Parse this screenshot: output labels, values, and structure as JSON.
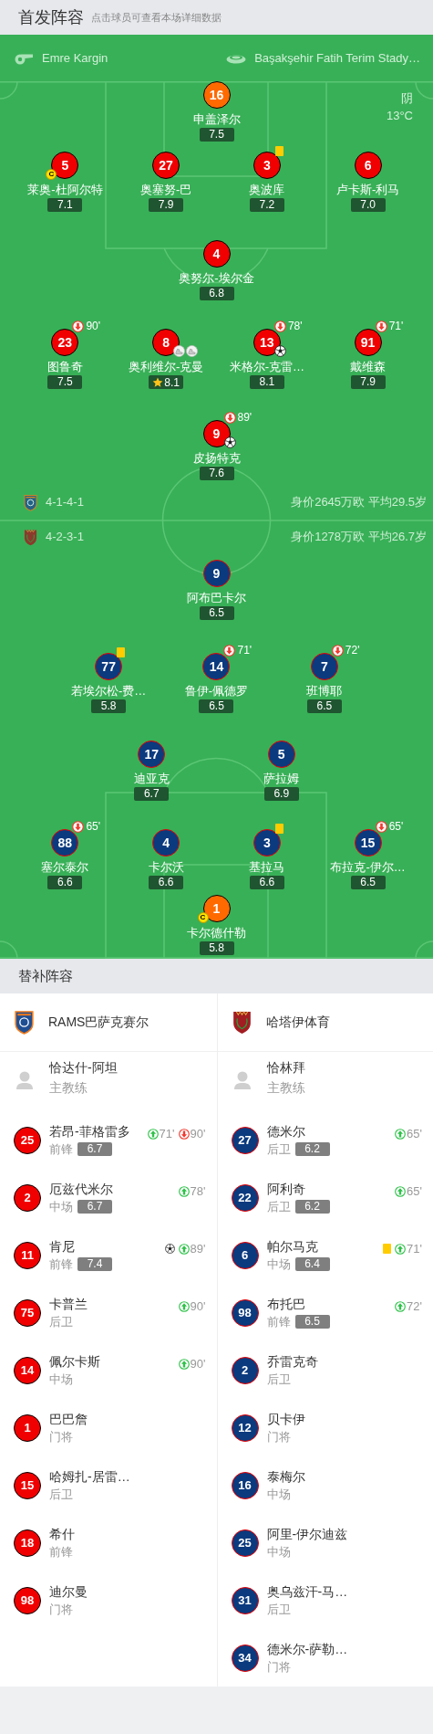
{
  "header": {
    "title": "首发阵容",
    "subtitle": "点击球员可查看本场详细数据"
  },
  "match_info": {
    "referee": "Emre Kargin",
    "stadium": "Başakşehir Fatih Terim Stady…",
    "weather": "阴",
    "temperature": "13°C"
  },
  "home": {
    "kind": "home",
    "formation": "4-1-4-1",
    "summary": "身价2645万欧 平均29.5岁",
    "rows": [
      [
        {
          "number": "16",
          "name": "申盖泽尔",
          "rating": "7.5",
          "kind": "goalkeeper"
        }
      ],
      [
        {
          "number": "5",
          "name": "莱奥-杜阿尔特",
          "rating": "7.1",
          "kind": "outfield",
          "events": [
            {
              "kind": "captain",
              "label": "C"
            }
          ]
        },
        {
          "number": "27",
          "name": "奥塞努-巴",
          "rating": "7.9",
          "kind": "outfield"
        },
        {
          "number": "3",
          "name": "奥波库",
          "rating": "7.2",
          "kind": "outfield",
          "events": [
            {
              "kind": "yellow_card"
            }
          ]
        },
        {
          "number": "6",
          "name": "卢卡斯-利马",
          "rating": "7.0",
          "kind": "outfield"
        }
      ],
      [
        {
          "number": "4",
          "name": "奥努尔-埃尔金",
          "rating": "6.8",
          "kind": "outfield"
        }
      ],
      [
        {
          "number": "23",
          "name": "图鲁奇",
          "rating": "7.5",
          "kind": "outfield",
          "events": [
            {
              "kind": "sub_off",
              "minute": "90'"
            }
          ]
        },
        {
          "number": "8",
          "name": "奥利维尔-克曼",
          "rating": "8.1",
          "kind": "outfield",
          "best": true,
          "events": [
            {
              "kind": "assist"
            },
            {
              "kind": "assist"
            }
          ]
        },
        {
          "number": "13",
          "name": "米格尔-克雷…",
          "rating": "8.1",
          "kind": "outfield",
          "events": [
            {
              "kind": "sub_off",
              "minute": "78'"
            },
            {
              "kind": "goal"
            }
          ]
        },
        {
          "number": "91",
          "name": "戴维森",
          "rating": "7.9",
          "kind": "outfield",
          "events": [
            {
              "kind": "sub_off",
              "minute": "71'"
            }
          ]
        }
      ],
      [
        {
          "number": "9",
          "name": "皮扬特克",
          "rating": "7.6",
          "kind": "outfield",
          "events": [
            {
              "kind": "sub_off",
              "minute": "89'"
            },
            {
              "kind": "goal"
            }
          ]
        }
      ]
    ]
  },
  "away": {
    "kind": "away",
    "formation": "4-2-3-1",
    "summary": "身价1278万欧 平均26.7岁",
    "rows": [
      [
        {
          "number": "9",
          "name": "阿布巴卡尔",
          "rating": "6.5",
          "kind": "outfield"
        }
      ],
      [
        {
          "number": "77",
          "name": "若埃尔松-费…",
          "rating": "5.8",
          "kind": "outfield",
          "events": [
            {
              "kind": "yellow_card"
            }
          ]
        },
        {
          "number": "14",
          "name": "鲁伊-佩德罗",
          "rating": "6.5",
          "kind": "outfield",
          "events": [
            {
              "kind": "sub_off",
              "minute": "71'"
            }
          ]
        },
        {
          "number": "7",
          "name": "班博耶",
          "rating": "6.5",
          "kind": "outfield",
          "events": [
            {
              "kind": "sub_off",
              "minute": "72'"
            }
          ]
        }
      ],
      [
        {
          "number": "17",
          "name": "迪亚克",
          "rating": "6.7",
          "kind": "outfield"
        },
        {
          "number": "5",
          "name": "萨拉姆",
          "rating": "6.9",
          "kind": "outfield"
        }
      ],
      [
        {
          "number": "88",
          "name": "塞尔泰尔",
          "rating": "6.6",
          "kind": "outfield",
          "events": [
            {
              "kind": "sub_off",
              "minute": "65'"
            }
          ]
        },
        {
          "number": "4",
          "name": "卡尔沃",
          "rating": "6.6",
          "kind": "outfield"
        },
        {
          "number": "3",
          "name": "基拉马",
          "rating": "6.6",
          "kind": "outfield",
          "events": [
            {
              "kind": "yellow_card"
            }
          ]
        },
        {
          "number": "15",
          "name": "布拉克-伊尔…",
          "rating": "6.5",
          "kind": "outfield",
          "events": [
            {
              "kind": "sub_off",
              "minute": "65'"
            }
          ]
        }
      ],
      [
        {
          "number": "1",
          "name": "卡尔德什勒",
          "rating": "5.8",
          "kind": "goalkeeper",
          "events": [
            {
              "kind": "captain",
              "label": "C"
            }
          ]
        }
      ]
    ]
  },
  "substitutes": {
    "title": "替补阵容",
    "teams": [
      {
        "kind": "home",
        "name": "RAMS巴萨克赛尔",
        "coach": {
          "name": "恰达什-阿坦",
          "role": "主教练"
        },
        "players": [
          {
            "number": "25",
            "name": "若昂-菲格雷多",
            "position": "前锋",
            "rating": "6.7",
            "events": [
              {
                "kind": "sub_in",
                "minute": "71'"
              },
              {
                "kind": "sub_out",
                "minute": "90'"
              }
            ]
          },
          {
            "number": "2",
            "name": "厄兹代米尔",
            "position": "中场",
            "rating": "6.7",
            "events": [
              {
                "kind": "sub_in",
                "minute": "78'"
              }
            ]
          },
          {
            "number": "11",
            "name": "肯尼",
            "position": "前锋",
            "rating": "7.4",
            "events": [
              {
                "kind": "goal"
              },
              {
                "kind": "sub_in",
                "minute": "89'"
              }
            ]
          },
          {
            "number": "75",
            "name": "卡普兰",
            "position": "后卫",
            "events": [
              {
                "kind": "sub_in",
                "minute": "90'"
              }
            ]
          },
          {
            "number": "14",
            "name": "佩尔卡斯",
            "position": "中场",
            "events": [
              {
                "kind": "sub_in",
                "minute": "90'"
              }
            ]
          },
          {
            "number": "1",
            "name": "巴巴詹",
            "position": "门将"
          },
          {
            "number": "15",
            "name": "哈姆扎-居雷…",
            "position": "后卫"
          },
          {
            "number": "18",
            "name": "希什",
            "position": "前锋"
          },
          {
            "number": "98",
            "name": "迪尔曼",
            "position": "门将"
          }
        ]
      },
      {
        "kind": "away",
        "name": "哈塔伊体育",
        "coach": {
          "name": "恰林拜",
          "role": "主教练"
        },
        "players": [
          {
            "number": "27",
            "name": "德米尔",
            "position": "后卫",
            "rating": "6.2",
            "events": [
              {
                "kind": "sub_in",
                "minute": "65'"
              }
            ]
          },
          {
            "number": "22",
            "name": "阿利奇",
            "position": "后卫",
            "rating": "6.2",
            "events": [
              {
                "kind": "sub_in",
                "minute": "65'"
              }
            ]
          },
          {
            "number": "6",
            "name": "帕尔马克",
            "position": "中场",
            "rating": "6.4",
            "events": [
              {
                "kind": "yellow_card"
              },
              {
                "kind": "sub_in",
                "minute": "71'"
              }
            ]
          },
          {
            "number": "98",
            "name": "布托巴",
            "position": "前锋",
            "rating": "6.5",
            "events": [
              {
                "kind": "sub_in",
                "minute": "72'"
              }
            ]
          },
          {
            "number": "2",
            "name": "乔雷克奇",
            "position": "后卫"
          },
          {
            "number": "12",
            "name": "贝卡伊",
            "position": "门将"
          },
          {
            "number": "16",
            "name": "泰梅尔",
            "position": "中场"
          },
          {
            "number": "25",
            "name": "阿里-伊尔迪兹",
            "position": "中场"
          },
          {
            "number": "31",
            "name": "奥乌兹汗-马…",
            "position": "后卫"
          },
          {
            "number": "34",
            "name": "德米尔-萨勒…",
            "position": "门将"
          }
        ]
      }
    ]
  }
}
